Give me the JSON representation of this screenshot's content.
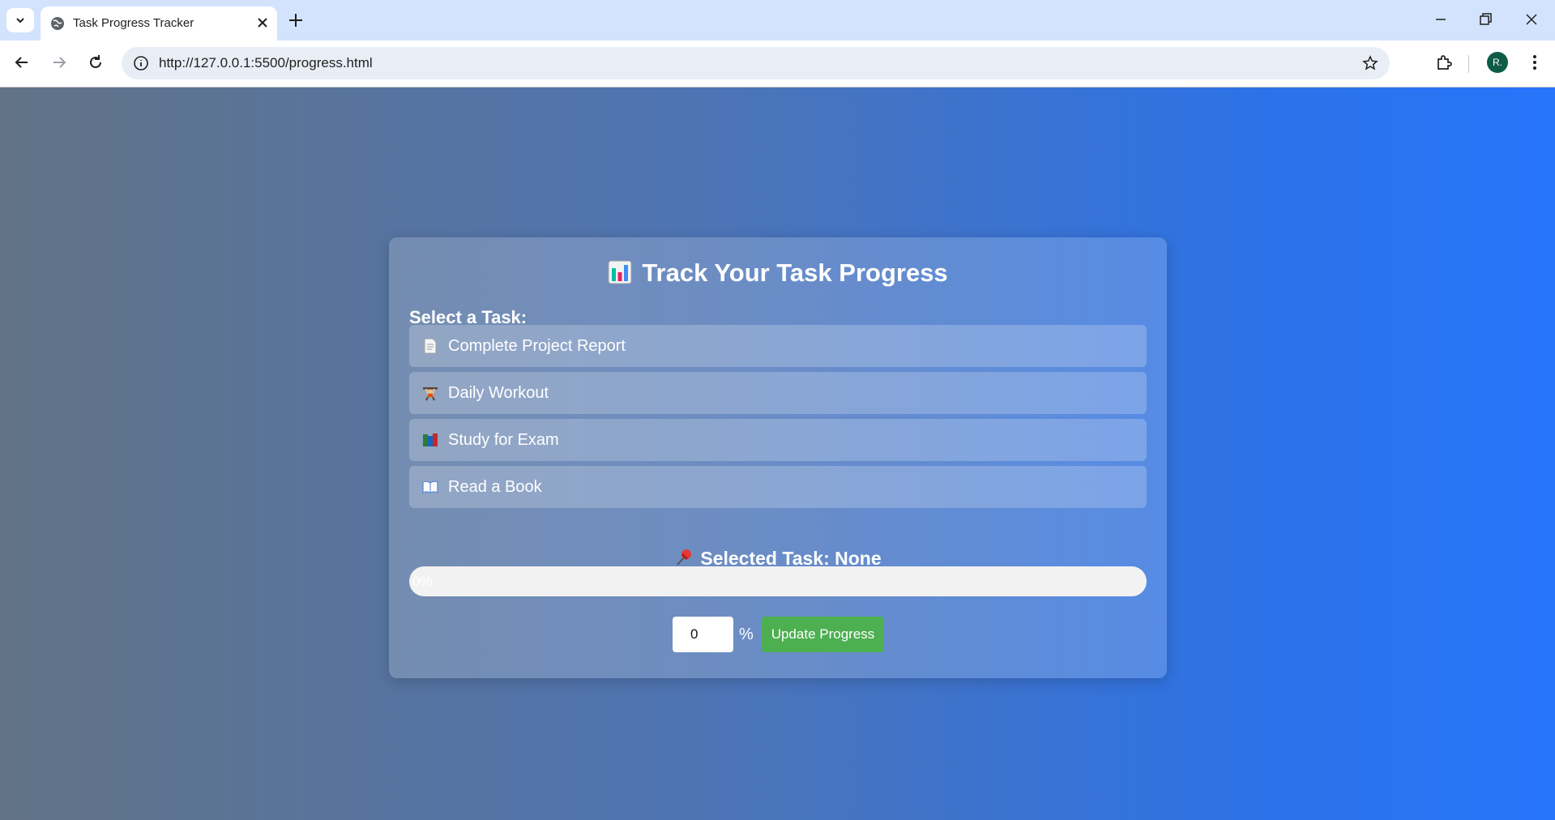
{
  "browser": {
    "tab_title": "Task Progress Tracker",
    "url": "http://127.0.0.1:5500/progress.html",
    "avatar_initial": "R."
  },
  "page": {
    "title": "Track Your Task Progress",
    "title_icon": "bar-chart-icon",
    "select_label": "Select a Task:",
    "tasks": [
      {
        "label": "Complete Project Report",
        "icon": "document-icon"
      },
      {
        "label": "Daily Workout",
        "icon": "weightlifter-icon"
      },
      {
        "label": "Study for Exam",
        "icon": "books-icon"
      },
      {
        "label": "Read a Book",
        "icon": "open-book-icon"
      }
    ],
    "selected_task_text": "Selected Task: None",
    "progress": {
      "value_percent": 0,
      "label": "0%"
    },
    "input_value": "0",
    "percent_sign": "%",
    "update_button": "Update Progress"
  },
  "colors": {
    "accent_green": "#4caf50",
    "gradient_start": "#627386",
    "gradient_end": "#2775fb"
  }
}
